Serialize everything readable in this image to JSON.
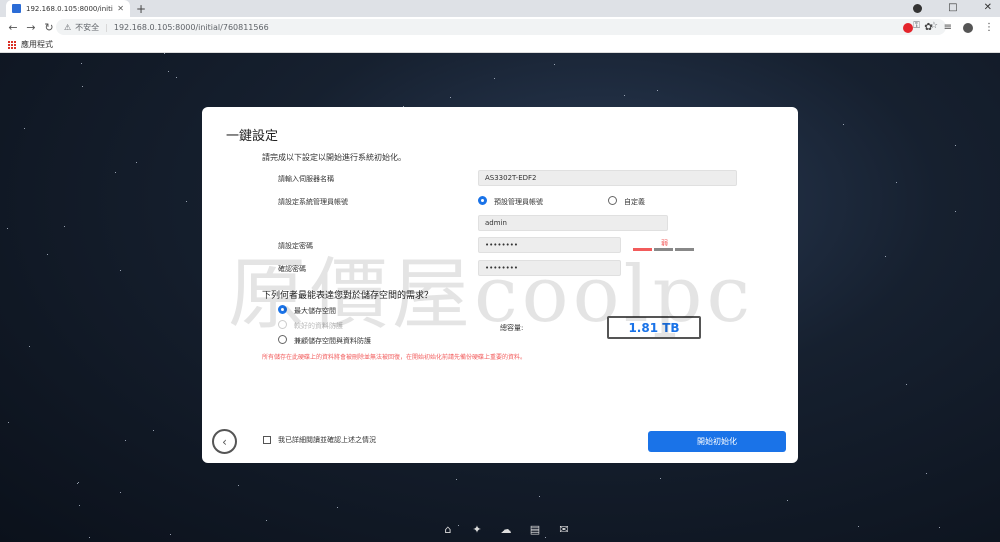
{
  "browser": {
    "tab_title": "192.168.0.105:8000/initial/760…",
    "new_tab": "+",
    "insecure_label": "不安全",
    "url": "192.168.0.105:8000/initial/760811566",
    "bookmarks_label": "應用程式"
  },
  "dialog": {
    "title": "一鍵設定",
    "intro": "請完成以下設定以開始進行系統初始化。",
    "server_name_label": "請輸入伺服器名稱",
    "server_name_value": "AS3302T-EDF2",
    "admin_account_label": "請設定系統管理員帳號",
    "admin_option_default": "預設管理員帳號",
    "admin_option_custom": "自定義",
    "admin_value": "admin",
    "password_label": "請設定密碼",
    "password_value": "••••••••",
    "password_strength": "弱",
    "password_strength_level": 0.33,
    "confirm_label": "確認密碼",
    "confirm_value": "••••••••",
    "storage_question": "下列何者最能表達您對於儲存空間的需求？",
    "storage_options": [
      "最大儲存空間",
      "較好的資料防護",
      "兼顧儲存空間與資料防護"
    ],
    "capacity_label": "總容量:",
    "capacity_value": "1.81 TB",
    "warning": "所有儲存在此硬碟上的資料將會被刪除並無法被回復，在開始初始化前請先備份硬碟上重要的資料。",
    "confirm_check_label": "我已詳細閱讀並確認上述之情況",
    "start_button": "開始初始化"
  },
  "watermark": "原價屋coolpc",
  "colors": {
    "accent": "#1a73e8",
    "warning": "#f25b5b"
  },
  "dock_icons": [
    "bank-icon",
    "puzzle-icon",
    "cloud-download-icon",
    "chat-icon",
    "mail-icon"
  ]
}
